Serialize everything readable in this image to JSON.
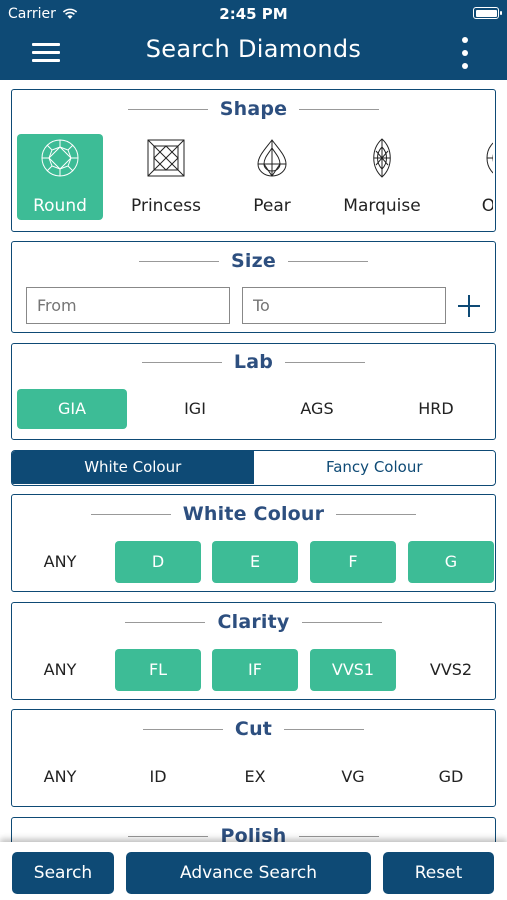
{
  "status_bar": {
    "carrier": "Carrier",
    "time": "2:45 PM"
  },
  "header": {
    "title": "Search Diamonds"
  },
  "shape": {
    "title": "Shape",
    "items": [
      {
        "label": "Round",
        "icon": "round-diamond-icon",
        "selected": true
      },
      {
        "label": "Princess",
        "icon": "princess-diamond-icon",
        "selected": false
      },
      {
        "label": "Pear",
        "icon": "pear-diamond-icon",
        "selected": false
      },
      {
        "label": "Marquise",
        "icon": "marquise-diamond-icon",
        "selected": false
      },
      {
        "label": "Oval",
        "icon": "oval-diamond-icon",
        "selected": false
      }
    ]
  },
  "size": {
    "title": "Size",
    "from_placeholder": "From",
    "to_placeholder": "To"
  },
  "lab": {
    "title": "Lab",
    "options": [
      {
        "label": "GIA",
        "selected": true
      },
      {
        "label": "IGI",
        "selected": false
      },
      {
        "label": "AGS",
        "selected": false
      },
      {
        "label": "HRD",
        "selected": false
      }
    ]
  },
  "colour_tabs": {
    "white": "White Colour",
    "fancy": "Fancy Colour",
    "active": "white"
  },
  "white_colour": {
    "title": "White Colour",
    "options": [
      {
        "label": "ANY",
        "selected": false
      },
      {
        "label": "D",
        "selected": true
      },
      {
        "label": "E",
        "selected": true
      },
      {
        "label": "F",
        "selected": true
      },
      {
        "label": "G",
        "selected": true
      }
    ]
  },
  "clarity": {
    "title": "Clarity",
    "options": [
      {
        "label": "ANY",
        "selected": false
      },
      {
        "label": "FL",
        "selected": true
      },
      {
        "label": "IF",
        "selected": true
      },
      {
        "label": "VVS1",
        "selected": true
      },
      {
        "label": "VVS2",
        "selected": false
      }
    ]
  },
  "cut": {
    "title": "Cut",
    "options": [
      {
        "label": "ANY",
        "selected": false
      },
      {
        "label": "ID",
        "selected": false
      },
      {
        "label": "EX",
        "selected": false
      },
      {
        "label": "VG",
        "selected": false
      },
      {
        "label": "GD",
        "selected": false
      }
    ]
  },
  "polish": {
    "title": "Polish"
  },
  "actions": {
    "search": "Search",
    "advance_search": "Advance Search",
    "reset": "Reset"
  },
  "colors": {
    "primary": "#0e4a75",
    "accent": "#3dbc96",
    "section_title": "#2d4f7f"
  }
}
